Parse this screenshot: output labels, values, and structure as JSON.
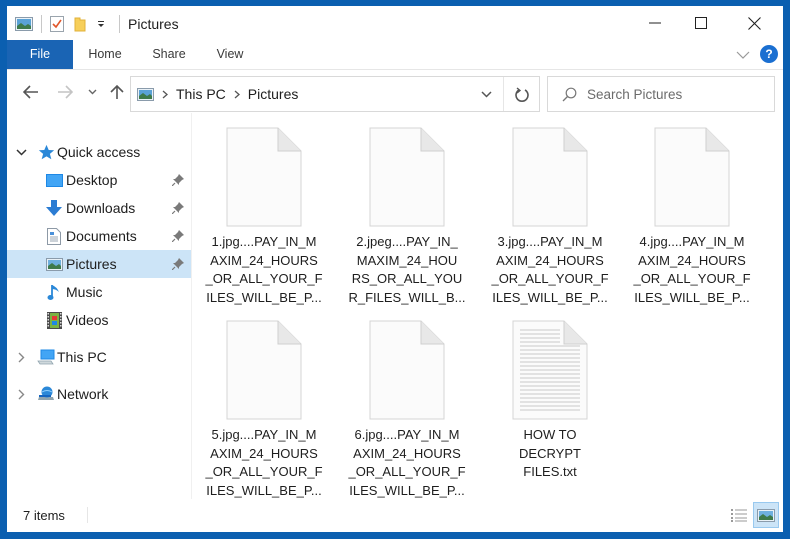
{
  "window": {
    "title": "Pictures",
    "controls": {
      "minimize": "minimize",
      "maximize": "maximize",
      "close": "close"
    }
  },
  "quick_access_toolbar": {
    "icons": [
      "pictures-folder-icon",
      "properties-icon",
      "new-folder-icon",
      "customize-dropdown-icon"
    ]
  },
  "ribbon": {
    "tabs": [
      {
        "label": "File",
        "active": true
      },
      {
        "label": "Home"
      },
      {
        "label": "Share"
      },
      {
        "label": "View"
      }
    ],
    "help_label": "?"
  },
  "navigation": {
    "breadcrumb": [
      "This PC",
      "Pictures"
    ],
    "search_placeholder": "Search Pictures",
    "search_value": ""
  },
  "sidebar": {
    "items": [
      {
        "label": "Quick access",
        "icon": "star-icon",
        "expanded": true,
        "level": 0
      },
      {
        "label": "Desktop",
        "icon": "desktop-icon",
        "pinned": true,
        "level": 1
      },
      {
        "label": "Downloads",
        "icon": "download-icon",
        "pinned": true,
        "level": 1
      },
      {
        "label": "Documents",
        "icon": "documents-icon",
        "pinned": true,
        "level": 1
      },
      {
        "label": "Pictures",
        "icon": "pictures-icon",
        "pinned": true,
        "level": 1,
        "selected": true
      },
      {
        "label": "Music",
        "icon": "music-icon",
        "level": 1
      },
      {
        "label": "Videos",
        "icon": "videos-icon",
        "level": 1
      },
      {
        "label": "This PC",
        "icon": "computer-icon",
        "expanded": false,
        "level": 0
      },
      {
        "label": "Network",
        "icon": "network-icon",
        "expanded": false,
        "level": 0
      }
    ]
  },
  "files": [
    {
      "name": "1.jpg....PAY_IN_MAXIM_24_HOURS_OR_ALL_YOUR_FILES_WILL_BE_P...",
      "lines": [
        "1.jpg....PAY_IN_M",
        "AXIM_24_HOURS",
        "_OR_ALL_YOUR_F",
        "ILES_WILL_BE_P..."
      ],
      "type": "blank"
    },
    {
      "name": "2.jpeg....PAY_IN_MAXIM_24_HOURS_OR_ALL_YOUR_FILES_WILL_B...",
      "lines": [
        "2.jpeg....PAY_IN_",
        "MAXIM_24_HOU",
        "RS_OR_ALL_YOU",
        "R_FILES_WILL_B..."
      ],
      "type": "blank"
    },
    {
      "name": "3.jpg....PAY_IN_MAXIM_24_HOURS_OR_ALL_YOUR_FILES_WILL_BE_P...",
      "lines": [
        "3.jpg....PAY_IN_M",
        "AXIM_24_HOURS",
        "_OR_ALL_YOUR_F",
        "ILES_WILL_BE_P..."
      ],
      "type": "blank"
    },
    {
      "name": "4.jpg....PAY_IN_MAXIM_24_HOURS_OR_ALL_YOUR_FILES_WILL_BE_P...",
      "lines": [
        "4.jpg....PAY_IN_M",
        "AXIM_24_HOURS",
        "_OR_ALL_YOUR_F",
        "ILES_WILL_BE_P..."
      ],
      "type": "blank"
    },
    {
      "name": "5.jpg....PAY_IN_MAXIM_24_HOURS_OR_ALL_YOUR_FILES_WILL_BE_P...",
      "lines": [
        "5.jpg....PAY_IN_M",
        "AXIM_24_HOURS",
        "_OR_ALL_YOUR_F",
        "ILES_WILL_BE_P..."
      ],
      "type": "blank"
    },
    {
      "name": "6.jpg....PAY_IN_MAXIM_24_HOURS_OR_ALL_YOUR_FILES_WILL_BE_P...",
      "lines": [
        "6.jpg....PAY_IN_M",
        "AXIM_24_HOURS",
        "_OR_ALL_YOUR_F",
        "ILES_WILL_BE_P..."
      ],
      "type": "blank"
    },
    {
      "name": "HOW TO DECRYPT FILES.txt",
      "lines": [
        "HOW TO",
        "DECRYPT",
        "FILES.txt"
      ],
      "type": "text"
    }
  ],
  "statusbar": {
    "item_count": "7 items"
  },
  "colors": {
    "accent": "#1a64b4",
    "selected_bg": "#cce4f7",
    "window_border": "#0b5fb0"
  }
}
